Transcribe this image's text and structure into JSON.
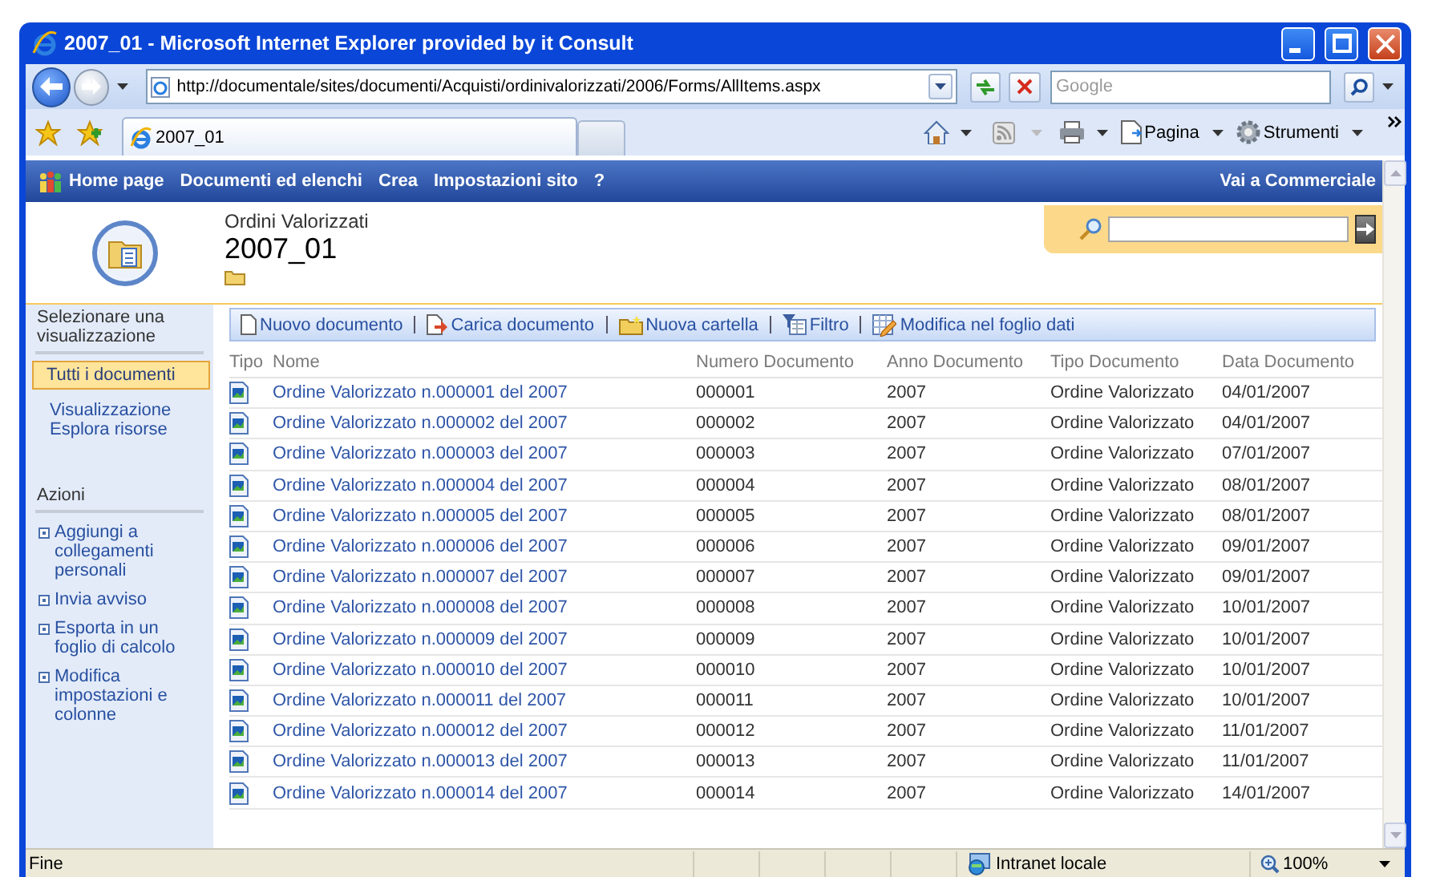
{
  "window": {
    "title": "2007_01 - Microsoft Internet Explorer provided by it Consult"
  },
  "address_bar": {
    "url": "http://documentale/sites/documenti/Acquisti/ordinivalorizzati/2006/Forms/AllItems.aspx",
    "search_placeholder": "Google"
  },
  "tabs": [
    {
      "label": "2007_01",
      "selected": true
    }
  ],
  "command_bar": {
    "items": [
      {
        "kind": "page",
        "label": "Pagina"
      },
      {
        "kind": "tools",
        "label": "Strumenti"
      }
    ]
  },
  "top_nav": {
    "items": [
      "Home page",
      "Documenti ed elenchi",
      "Crea",
      "Impostazioni sito",
      "?"
    ],
    "right_link": "Vai a Commerciale"
  },
  "header": {
    "breadcrumb": "Ordini Valorizzati",
    "title": "2007_01"
  },
  "left_nav": {
    "views_heading": "Selezionare una visualizzazione",
    "views": [
      {
        "label": "Tutti i documenti",
        "selected": true
      },
      {
        "label": "Visualizzazione Esplora risorse",
        "selected": false
      }
    ],
    "actions_heading": "Azioni",
    "actions": [
      "Aggiungi a collegamenti personali",
      "Invia avviso",
      "Esporta in un foglio di calcolo",
      "Modifica impostazioni e colonne"
    ]
  },
  "toolbar": [
    {
      "kind": "new",
      "label": "Nuovo documento"
    },
    {
      "kind": "upload",
      "label": "Carica documento"
    },
    {
      "kind": "folder",
      "label": "Nuova cartella"
    },
    {
      "kind": "filter",
      "label": "Filtro"
    },
    {
      "kind": "datasheet",
      "label": "Modifica nel foglio dati"
    }
  ],
  "table": {
    "columns": [
      "Tipo",
      "Nome",
      "Numero Documento",
      "Anno Documento",
      "Tipo Documento",
      "Data Documento"
    ],
    "rows": [
      {
        "name": "Ordine Valorizzato n.000001 del 2007",
        "number": "000001",
        "year": "2007",
        "type": "Ordine Valorizzato",
        "date": "04/01/2007"
      },
      {
        "name": "Ordine Valorizzato n.000002 del 2007",
        "number": "000002",
        "year": "2007",
        "type": "Ordine Valorizzato",
        "date": "04/01/2007"
      },
      {
        "name": "Ordine Valorizzato n.000003 del 2007",
        "number": "000003",
        "year": "2007",
        "type": "Ordine Valorizzato",
        "date": "07/01/2007"
      },
      {
        "name": "Ordine Valorizzato n.000004 del 2007",
        "number": "000004",
        "year": "2007",
        "type": "Ordine Valorizzato",
        "date": "08/01/2007"
      },
      {
        "name": "Ordine Valorizzato n.000005 del 2007",
        "number": "000005",
        "year": "2007",
        "type": "Ordine Valorizzato",
        "date": "08/01/2007"
      },
      {
        "name": "Ordine Valorizzato n.000006 del 2007",
        "number": "000006",
        "year": "2007",
        "type": "Ordine Valorizzato",
        "date": "09/01/2007"
      },
      {
        "name": "Ordine Valorizzato n.000007 del 2007",
        "number": "000007",
        "year": "2007",
        "type": "Ordine Valorizzato",
        "date": "09/01/2007"
      },
      {
        "name": "Ordine Valorizzato n.000008 del 2007",
        "number": "000008",
        "year": "2007",
        "type": "Ordine Valorizzato",
        "date": "10/01/2007"
      },
      {
        "name": "Ordine Valorizzato n.000009 del 2007",
        "number": "000009",
        "year": "2007",
        "type": "Ordine Valorizzato",
        "date": "10/01/2007"
      },
      {
        "name": "Ordine Valorizzato n.000010 del 2007",
        "number": "000010",
        "year": "2007",
        "type": "Ordine Valorizzato",
        "date": "10/01/2007"
      },
      {
        "name": "Ordine Valorizzato n.000011 del 2007",
        "number": "000011",
        "year": "2007",
        "type": "Ordine Valorizzato",
        "date": "10/01/2007"
      },
      {
        "name": "Ordine Valorizzato n.000012 del 2007",
        "number": "000012",
        "year": "2007",
        "type": "Ordine Valorizzato",
        "date": "11/01/2007"
      },
      {
        "name": "Ordine Valorizzato n.000013 del 2007",
        "number": "000013",
        "year": "2007",
        "type": "Ordine Valorizzato",
        "date": "11/01/2007"
      },
      {
        "name": "Ordine Valorizzato n.000014 del 2007",
        "number": "000014",
        "year": "2007",
        "type": "Ordine Valorizzato",
        "date": "14/01/2007"
      }
    ]
  },
  "status_bar": {
    "text": "Fine",
    "zone": "Intranet locale",
    "zoom": "100%"
  }
}
